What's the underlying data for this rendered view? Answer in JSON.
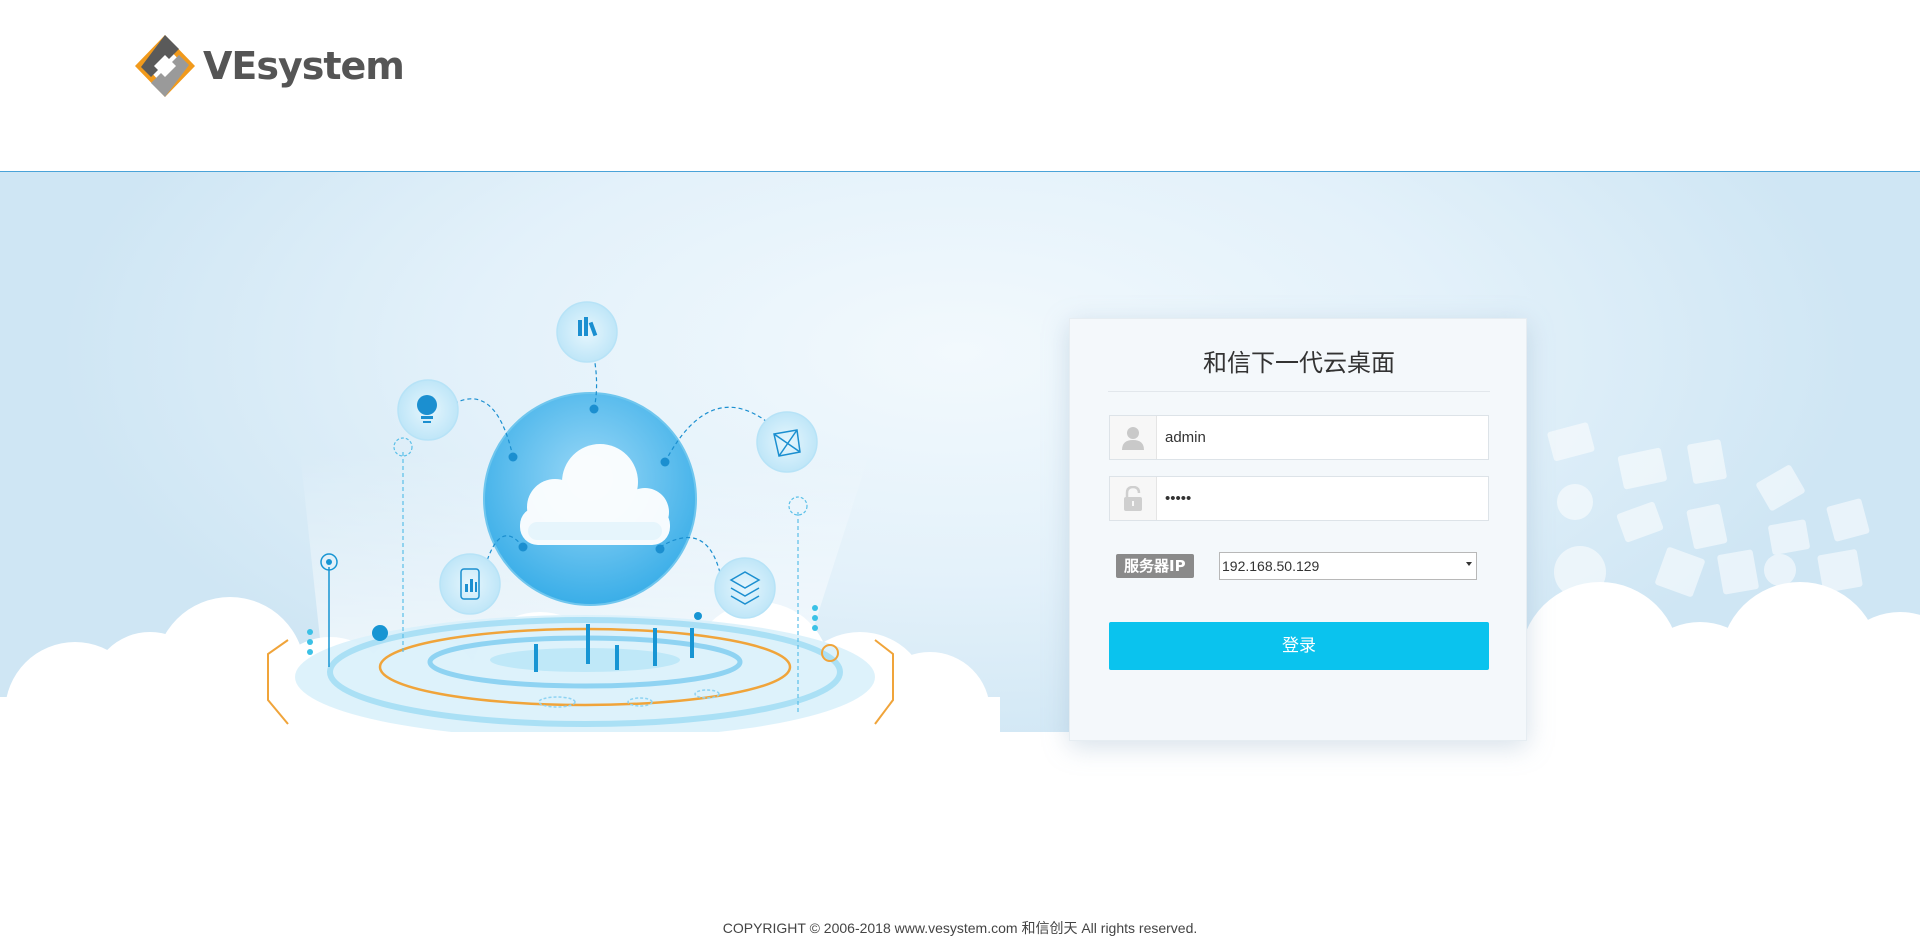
{
  "brand": {
    "name": "VEsystem",
    "colors": {
      "orange": "#f19a1c",
      "grey": "#555555",
      "accent": "#0ac3ee"
    }
  },
  "login": {
    "title": "和信下一代云桌面",
    "username_value": "admin",
    "password_value": "•••••",
    "server_label": "服务器IP",
    "server_ip": "192.168.50.129",
    "submit_label": "登录"
  },
  "icons": {
    "user": "user-icon",
    "lock": "lock-icon",
    "dropdown": "chevron-down-icon"
  },
  "footer": {
    "copyright": "COPYRIGHT © 2006-2018 www.vesystem.com 和信创天 All rights reserved."
  }
}
